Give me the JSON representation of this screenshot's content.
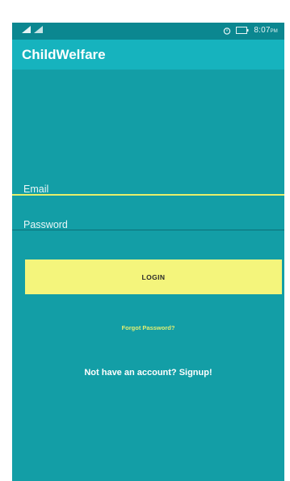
{
  "status_bar": {
    "time": "8:07",
    "time_suffix": "PM",
    "battery_label": "100",
    "icons": [
      "signal-icon",
      "wifi-icon",
      "alarm-icon",
      "battery-icon"
    ]
  },
  "app_bar": {
    "title": "ChildWelfare"
  },
  "form": {
    "email_placeholder": "Email",
    "email_value": "",
    "password_placeholder": "Password",
    "password_value": "",
    "login_label": "LOGIN",
    "forgot_label": "Forgot Password?",
    "signup_label": "Not have an account? Signup!"
  },
  "colors": {
    "background": "#139ea6",
    "app_bar": "#16b3be",
    "status_bar": "#0b8790",
    "button": "#f4f57c",
    "accent": "#e6ef6a"
  }
}
